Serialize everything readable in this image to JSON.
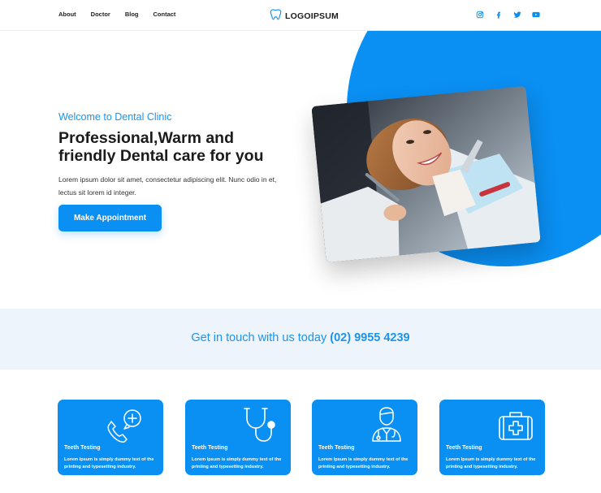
{
  "nav": {
    "items": [
      "About",
      "Doctor",
      "Blog",
      "Contact"
    ]
  },
  "logo": {
    "text": "LOGOIPSUM",
    "icon": "tooth-icon"
  },
  "social": {
    "icons": [
      "instagram-icon",
      "facebook-icon",
      "twitter-icon",
      "youtube-icon"
    ]
  },
  "hero": {
    "welcome": "Welcome to Dental Clinic",
    "headline_line1": "Professional,Warm and",
    "headline_line2": "friendly Dental care for you",
    "description": "Lorem ipsum dolor sit amet, consectetur adipiscing elit. Nunc odio in et, lectus sit lorem id integer.",
    "cta_label": "Make Appointment"
  },
  "contact": {
    "text": "Get in touch with us today",
    "phone": "(02) 9955 4239"
  },
  "services": [
    {
      "icon": "phone-plus-icon",
      "title": "Teeth Testing",
      "text": "Lorem Ipsum is simply dummy text of the printing and typesetting industry."
    },
    {
      "icon": "stethoscope-icon",
      "title": "Teeth Testing",
      "text": "Lorem Ipsum is simply dummy text of the printing and typesetting industry."
    },
    {
      "icon": "doctor-icon",
      "title": "Teeth Testing",
      "text": "Lorem Ipsum is simply dummy text of the printing and typesetting industry."
    },
    {
      "icon": "first-aid-kit-icon",
      "title": "Teeth Testing",
      "text": "Lorem Ipsum is simply dummy text of the printing and typesetting industry."
    }
  ],
  "colors": {
    "accent": "#0a8ff3",
    "strip_bg": "#eef4fb",
    "text": "#1b1b1b"
  }
}
